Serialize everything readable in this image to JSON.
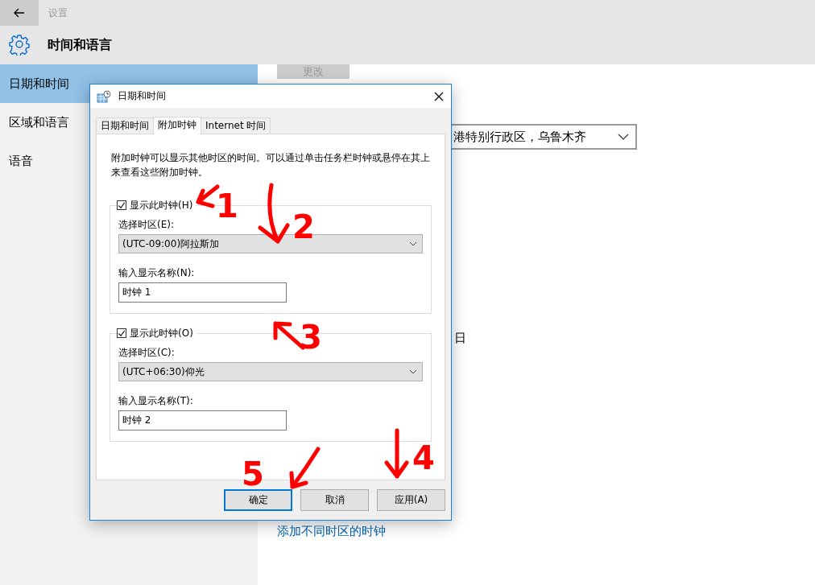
{
  "app_bar": {
    "title": "设置"
  },
  "page": {
    "title": "时间和语言"
  },
  "sidebar": {
    "items": [
      {
        "label": "日期和时间",
        "selected": true
      },
      {
        "label": "区域和语言",
        "selected": false
      },
      {
        "label": "语音",
        "selected": false
      }
    ]
  },
  "content": {
    "change_button": "更改",
    "timezone_dropdown": "港特别行政区，乌鲁木齐",
    "date_fragment": "日",
    "add_clock_link": "添加不同时区的时钟"
  },
  "dialog": {
    "title": "日期和时间",
    "tabs": [
      {
        "label": "日期和时间",
        "selected": false
      },
      {
        "label": "附加时钟",
        "selected": true
      },
      {
        "label": "Internet 时间",
        "selected": false
      }
    ],
    "description": "附加时钟可以显示其他时区的时间。可以通过单击任务栏时钟或悬停在其上来查看这些附加时钟。",
    "clocks": [
      {
        "show_label": "显示此时钟(H)",
        "checked": true,
        "timezone_label": "选择时区(E):",
        "timezone": "(UTC-09:00)阿拉斯加",
        "name_label": "输入显示名称(N):",
        "name": "时钟 1"
      },
      {
        "show_label": "显示此时钟(O)",
        "checked": true,
        "timezone_label": "选择时区(C):",
        "timezone": "(UTC+06:30)仰光",
        "name_label": "输入显示名称(T):",
        "name": "时钟 2"
      }
    ],
    "buttons": [
      {
        "label": "确定",
        "focused": true
      },
      {
        "label": "取消",
        "focused": false
      },
      {
        "label": "应用(A)",
        "focused": false
      }
    ]
  },
  "annotations": [
    {
      "label": "1"
    },
    {
      "label": "2"
    },
    {
      "label": "3"
    },
    {
      "label": "4"
    },
    {
      "label": "5"
    }
  ]
}
